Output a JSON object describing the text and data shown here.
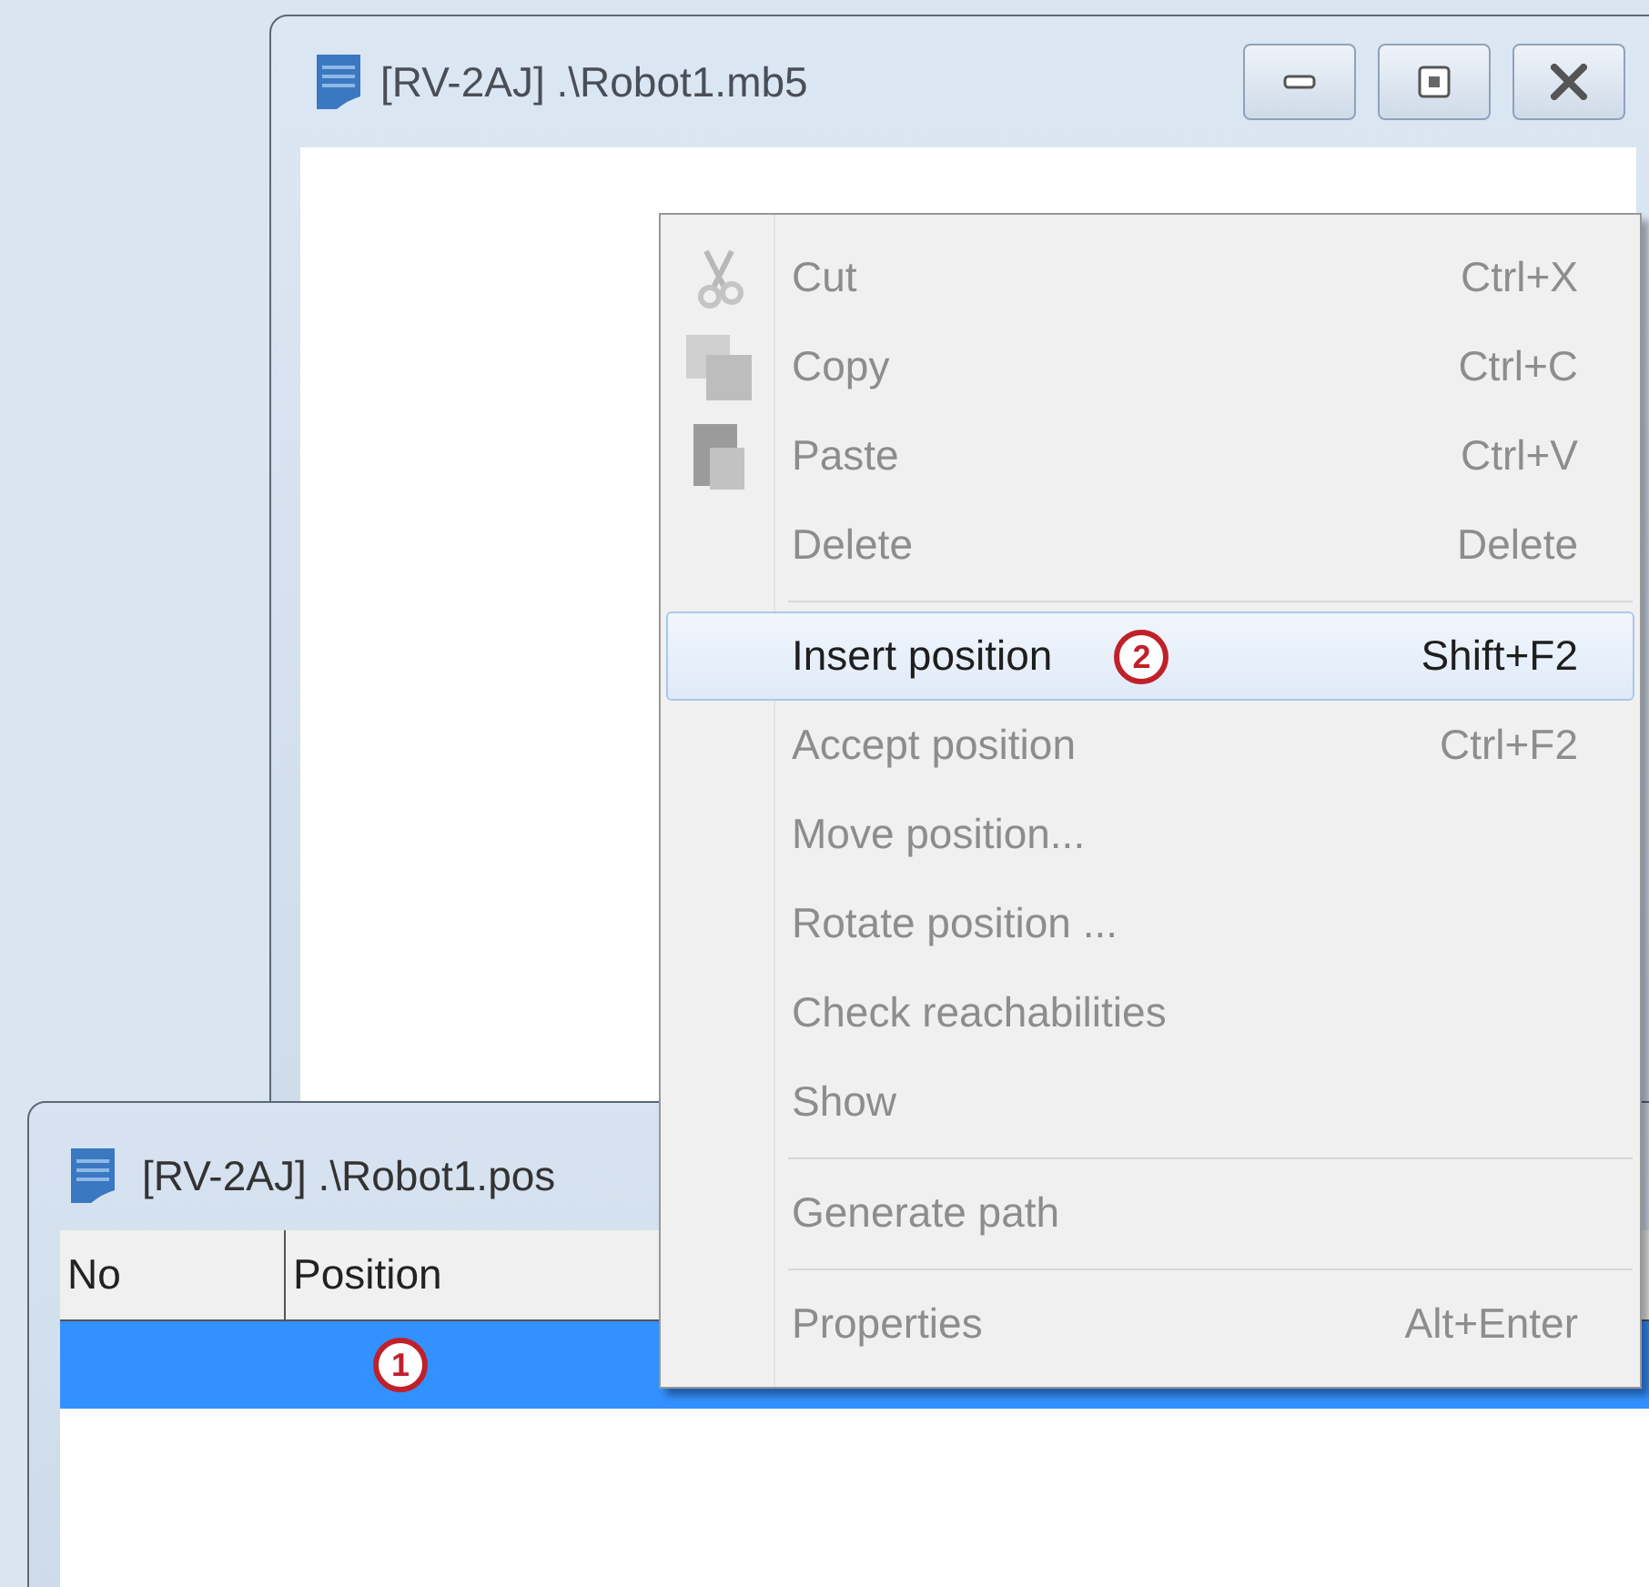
{
  "main_window": {
    "title": "[RV-2AJ] .\\Robot1.mb5"
  },
  "context_menu": {
    "items": [
      {
        "kind": "item",
        "label": "Cut",
        "shortcut": "Ctrl+X",
        "disabled": true,
        "selected": false
      },
      {
        "kind": "item",
        "label": "Copy",
        "shortcut": "Ctrl+C",
        "disabled": true,
        "selected": false
      },
      {
        "kind": "item",
        "label": "Paste",
        "shortcut": "Ctrl+V",
        "disabled": true,
        "selected": false
      },
      {
        "kind": "item",
        "label": "Delete",
        "shortcut": "Delete",
        "disabled": true,
        "selected": false
      },
      {
        "kind": "separator"
      },
      {
        "kind": "item",
        "label": "Insert position",
        "annotation": "2",
        "shortcut": "Shift+F2",
        "disabled": false,
        "selected": true
      },
      {
        "kind": "item",
        "label": "Accept position",
        "shortcut": "Ctrl+F2",
        "disabled": true,
        "selected": false
      },
      {
        "kind": "item",
        "label": "Move position...",
        "disabled": true,
        "selected": false
      },
      {
        "kind": "item",
        "label": "Rotate position ...",
        "disabled": true,
        "selected": false
      },
      {
        "kind": "item",
        "label": "Check reachabilities",
        "disabled": true,
        "selected": false
      },
      {
        "kind": "item",
        "label": "Show",
        "disabled": true,
        "selected": false
      },
      {
        "kind": "separator"
      },
      {
        "kind": "item",
        "label": "Generate path",
        "disabled": true,
        "selected": false
      },
      {
        "kind": "separator"
      },
      {
        "kind": "item",
        "label": "Properties",
        "shortcut": "Alt+Enter",
        "disabled": true,
        "selected": false
      }
    ]
  },
  "position_window": {
    "title": "[RV-2AJ] .\\Robot1.pos",
    "table": {
      "columns": [
        "No",
        "Position"
      ],
      "rows": [
        {
          "annotation": "1",
          "selected": true
        }
      ]
    }
  }
}
